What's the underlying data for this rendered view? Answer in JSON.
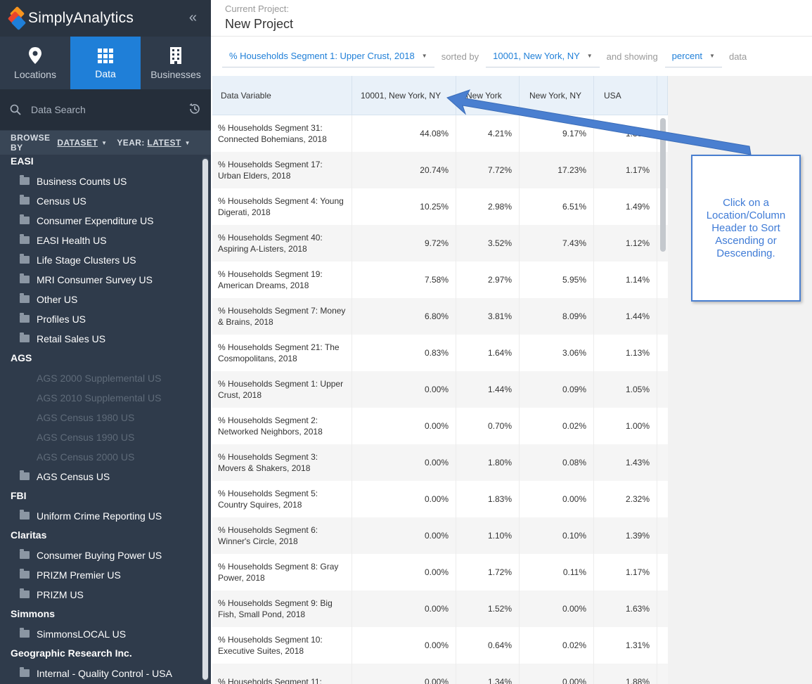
{
  "app": {
    "name": "SimplyAnalytics",
    "collapse_glyph": "«"
  },
  "nav_tabs": [
    {
      "label": "Locations",
      "icon": "map-pin-icon",
      "active": false
    },
    {
      "label": "Data",
      "icon": "data-grid-icon",
      "active": true
    },
    {
      "label": "Businesses",
      "icon": "building-icon",
      "active": false
    }
  ],
  "search": {
    "placeholder": "Data Search"
  },
  "browse": {
    "browse_by": "BROWSE BY",
    "dataset": "DATASET",
    "year_label": "YEAR:",
    "year_value": "LATEST"
  },
  "dataset_groups": [
    {
      "name": "EASI",
      "items": [
        {
          "label": "Business Counts US",
          "enabled": true
        },
        {
          "label": "Census US",
          "enabled": true
        },
        {
          "label": "Consumer Expenditure US",
          "enabled": true
        },
        {
          "label": "EASI Health US",
          "enabled": true
        },
        {
          "label": "Life Stage Clusters US",
          "enabled": true
        },
        {
          "label": "MRI Consumer Survey US",
          "enabled": true
        },
        {
          "label": "Other US",
          "enabled": true
        },
        {
          "label": "Profiles US",
          "enabled": true
        },
        {
          "label": "Retail Sales US",
          "enabled": true
        }
      ]
    },
    {
      "name": "AGS",
      "items": [
        {
          "label": "AGS 2000 Supplemental US",
          "enabled": false
        },
        {
          "label": "AGS 2010 Supplemental US",
          "enabled": false
        },
        {
          "label": "AGS Census 1980 US",
          "enabled": false
        },
        {
          "label": "AGS Census 1990 US",
          "enabled": false
        },
        {
          "label": "AGS Census 2000 US",
          "enabled": false
        },
        {
          "label": "AGS Census US",
          "enabled": true
        }
      ]
    },
    {
      "name": "FBI",
      "items": [
        {
          "label": "Uniform Crime Reporting US",
          "enabled": true
        }
      ]
    },
    {
      "name": "Claritas",
      "items": [
        {
          "label": "Consumer Buying Power US",
          "enabled": true
        },
        {
          "label": "PRIZM Premier US",
          "enabled": true
        },
        {
          "label": "PRIZM US",
          "enabled": true
        }
      ]
    },
    {
      "name": "Simmons",
      "items": [
        {
          "label": "SimmonsLOCAL US",
          "enabled": true
        }
      ]
    },
    {
      "name": "Geographic Research Inc.",
      "items": [
        {
          "label": "Internal - Quality Control - USA",
          "enabled": true
        }
      ]
    }
  ],
  "project": {
    "label": "Current Project:",
    "name": "New Project"
  },
  "controls": {
    "variable": "% Households Segment 1: Upper Crust, 2018",
    "sorted_by_text": "sorted by",
    "sort_location": "10001, New York, NY",
    "showing_text": "and showing",
    "showing_value": "percent",
    "suffix_text": "data"
  },
  "table": {
    "headers": [
      "Data Variable",
      "10001, New York, NY",
      "New York",
      "New York, NY",
      "USA"
    ],
    "rows": [
      [
        "% Households Segment 31: Connected Bohemians, 2018",
        "44.08%",
        "4.21%",
        "9.17%",
        "1.33%"
      ],
      [
        "% Households Segment 17: Urban Elders, 2018",
        "20.74%",
        "7.72%",
        "17.23%",
        "1.17%"
      ],
      [
        "% Households Segment 4: Young Digerati, 2018",
        "10.25%",
        "2.98%",
        "6.51%",
        "1.49%"
      ],
      [
        "% Households Segment 40: Aspiring A-Listers, 2018",
        "9.72%",
        "3.52%",
        "7.43%",
        "1.12%"
      ],
      [
        "% Households Segment 19: American Dreams, 2018",
        "7.58%",
        "2.97%",
        "5.95%",
        "1.14%"
      ],
      [
        "% Households Segment 7: Money & Brains, 2018",
        "6.80%",
        "3.81%",
        "8.09%",
        "1.44%"
      ],
      [
        "% Households Segment 21: The Cosmopolitans, 2018",
        "0.83%",
        "1.64%",
        "3.06%",
        "1.13%"
      ],
      [
        "% Households Segment 1: Upper Crust, 2018",
        "0.00%",
        "1.44%",
        "0.09%",
        "1.05%"
      ],
      [
        "% Households Segment 2: Networked Neighbors, 2018",
        "0.00%",
        "0.70%",
        "0.02%",
        "1.00%"
      ],
      [
        "% Households Segment 3: Movers & Shakers, 2018",
        "0.00%",
        "1.80%",
        "0.08%",
        "1.43%"
      ],
      [
        "% Households Segment 5: Country Squires, 2018",
        "0.00%",
        "1.83%",
        "0.00%",
        "2.32%"
      ],
      [
        "% Households Segment 6: Winner's Circle, 2018",
        "0.00%",
        "1.10%",
        "0.10%",
        "1.39%"
      ],
      [
        "% Households Segment 8: Gray Power, 2018",
        "0.00%",
        "1.72%",
        "0.11%",
        "1.17%"
      ],
      [
        "% Households Segment 9: Big Fish, Small Pond, 2018",
        "0.00%",
        "1.52%",
        "0.00%",
        "1.63%"
      ],
      [
        "% Households Segment 10: Executive Suites, 2018",
        "0.00%",
        "0.64%",
        "0.02%",
        "1.31%"
      ],
      [
        "% Households Segment 11:",
        "0.00%",
        "1.34%",
        "0.00%",
        "1.88%"
      ]
    ]
  },
  "callout": {
    "text": "Click on a Location/Column Header to Sort Ascending or Descending."
  },
  "colors": {
    "accent": "#1f7fd8",
    "sidebar": "#2f3b4b",
    "callout": "#4a7fd0"
  }
}
